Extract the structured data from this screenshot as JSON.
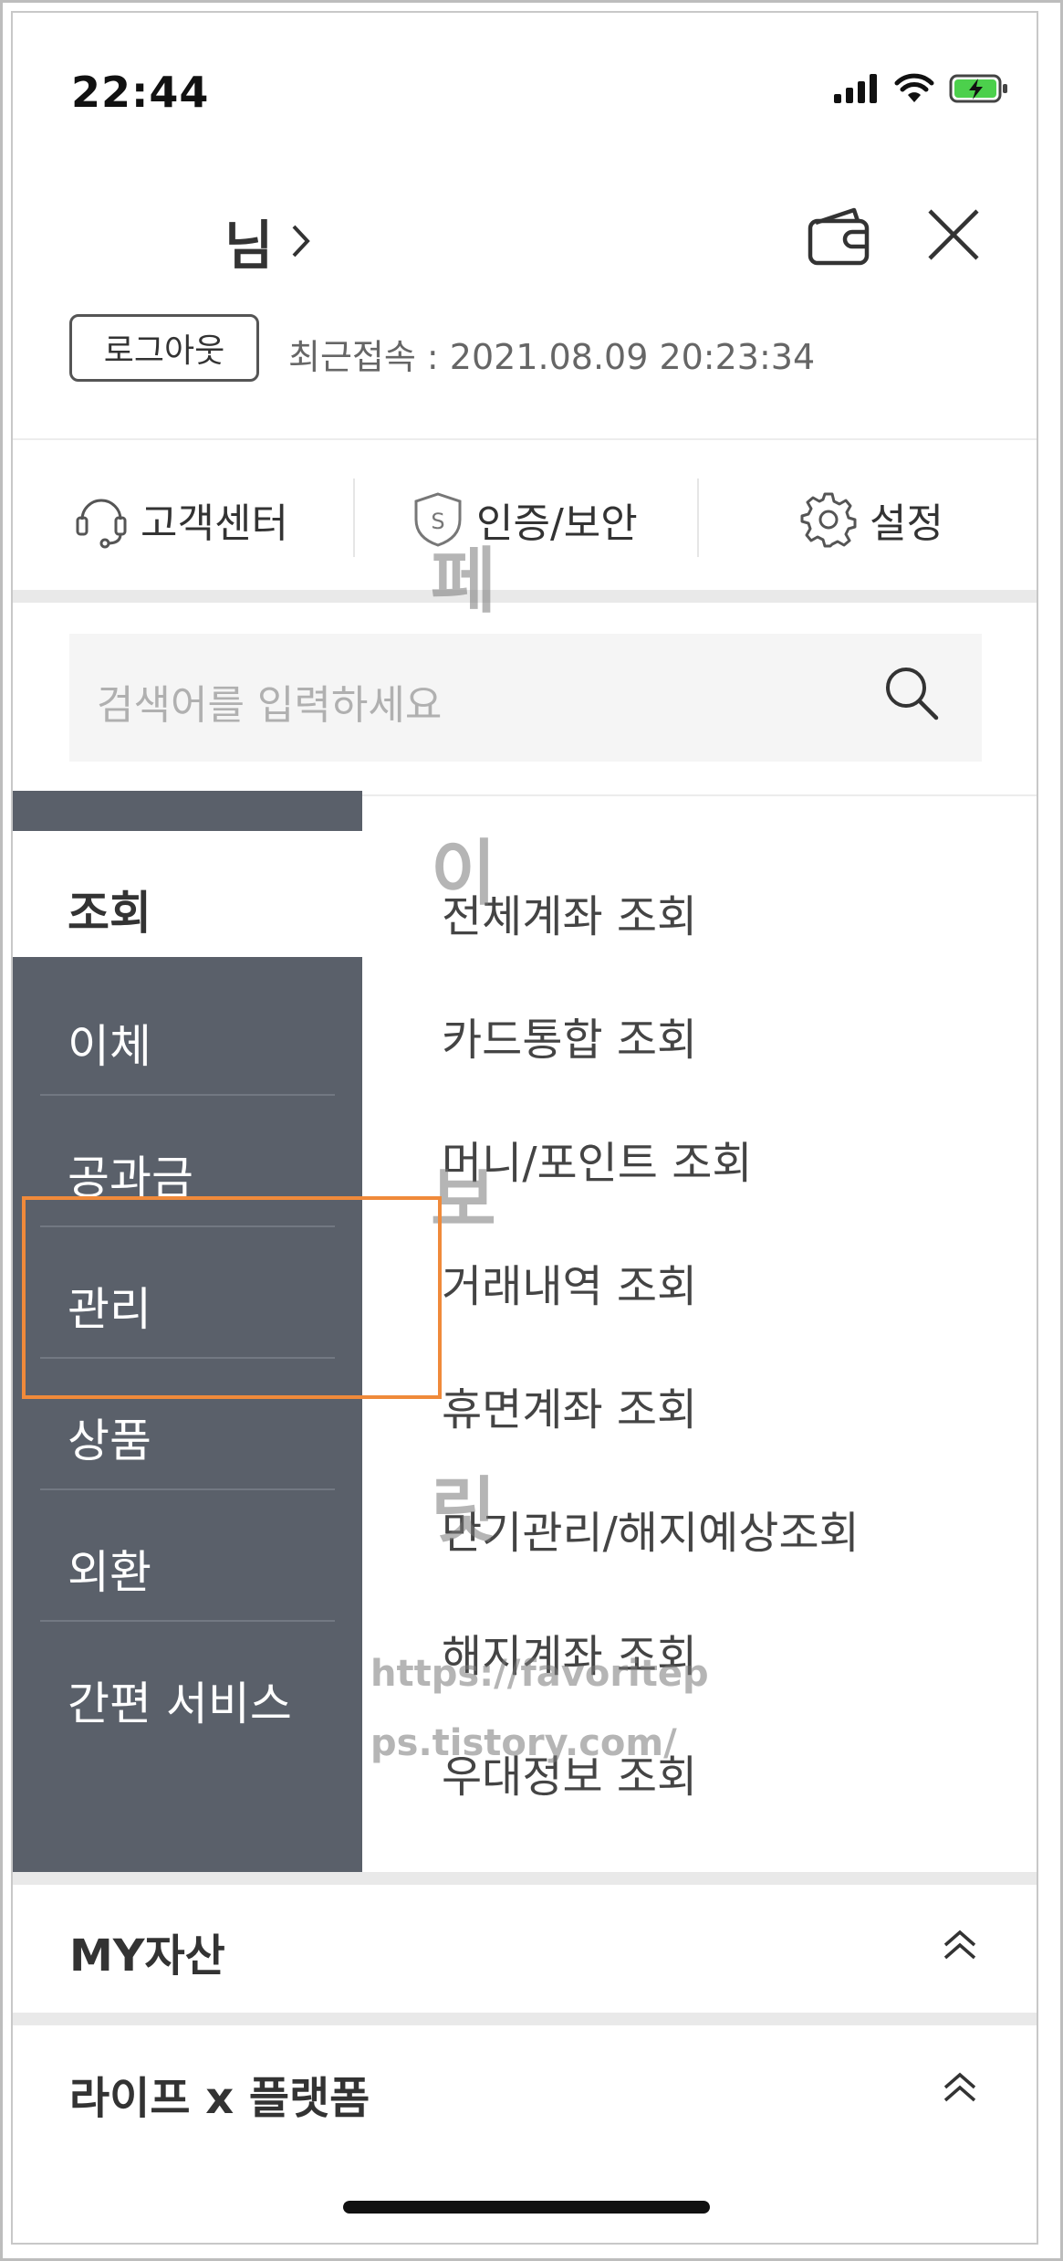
{
  "status_bar": {
    "time": "22:44"
  },
  "header": {
    "user_suffix": "님",
    "logout_label": "로그아웃",
    "last_login": "최근접속 : 2021.08.09 20:23:34"
  },
  "quick_links": [
    {
      "label": "고객센터",
      "icon": "headset-icon"
    },
    {
      "label": "인증/보안",
      "icon": "shield-icon"
    },
    {
      "label": "설정",
      "icon": "gear-icon"
    }
  ],
  "search": {
    "placeholder": "검색어를 입력하세요"
  },
  "left_menu": {
    "items": [
      {
        "label": "조회",
        "active": true
      },
      {
        "label": "이체"
      },
      {
        "label": "공과금"
      },
      {
        "label": "관리"
      },
      {
        "label": "상품"
      },
      {
        "label": "외환"
      },
      {
        "label": "간편 서비스"
      }
    ]
  },
  "sub_menu": {
    "items": [
      {
        "label": "전체계좌 조회"
      },
      {
        "label": "카드통합 조회"
      },
      {
        "label": "머니/포인트 조회"
      },
      {
        "label": "거래내역 조회"
      },
      {
        "label": "휴면계좌 조회"
      },
      {
        "label": "만기관리/해지예상조회"
      },
      {
        "label": "해지계좌 조회"
      },
      {
        "label": "우대정보 조회"
      }
    ]
  },
  "watermark": {
    "chars": [
      "페",
      "이",
      "보",
      "릿"
    ],
    "url_line1": "https://favoritep",
    "url_line2": "ps.tistory.com/"
  },
  "sections": [
    {
      "title": "MY자산"
    },
    {
      "title": "라이프 x 플랫폼"
    }
  ],
  "colors": {
    "menu_bg": "#5a606a",
    "highlight": "#f08a3a"
  }
}
